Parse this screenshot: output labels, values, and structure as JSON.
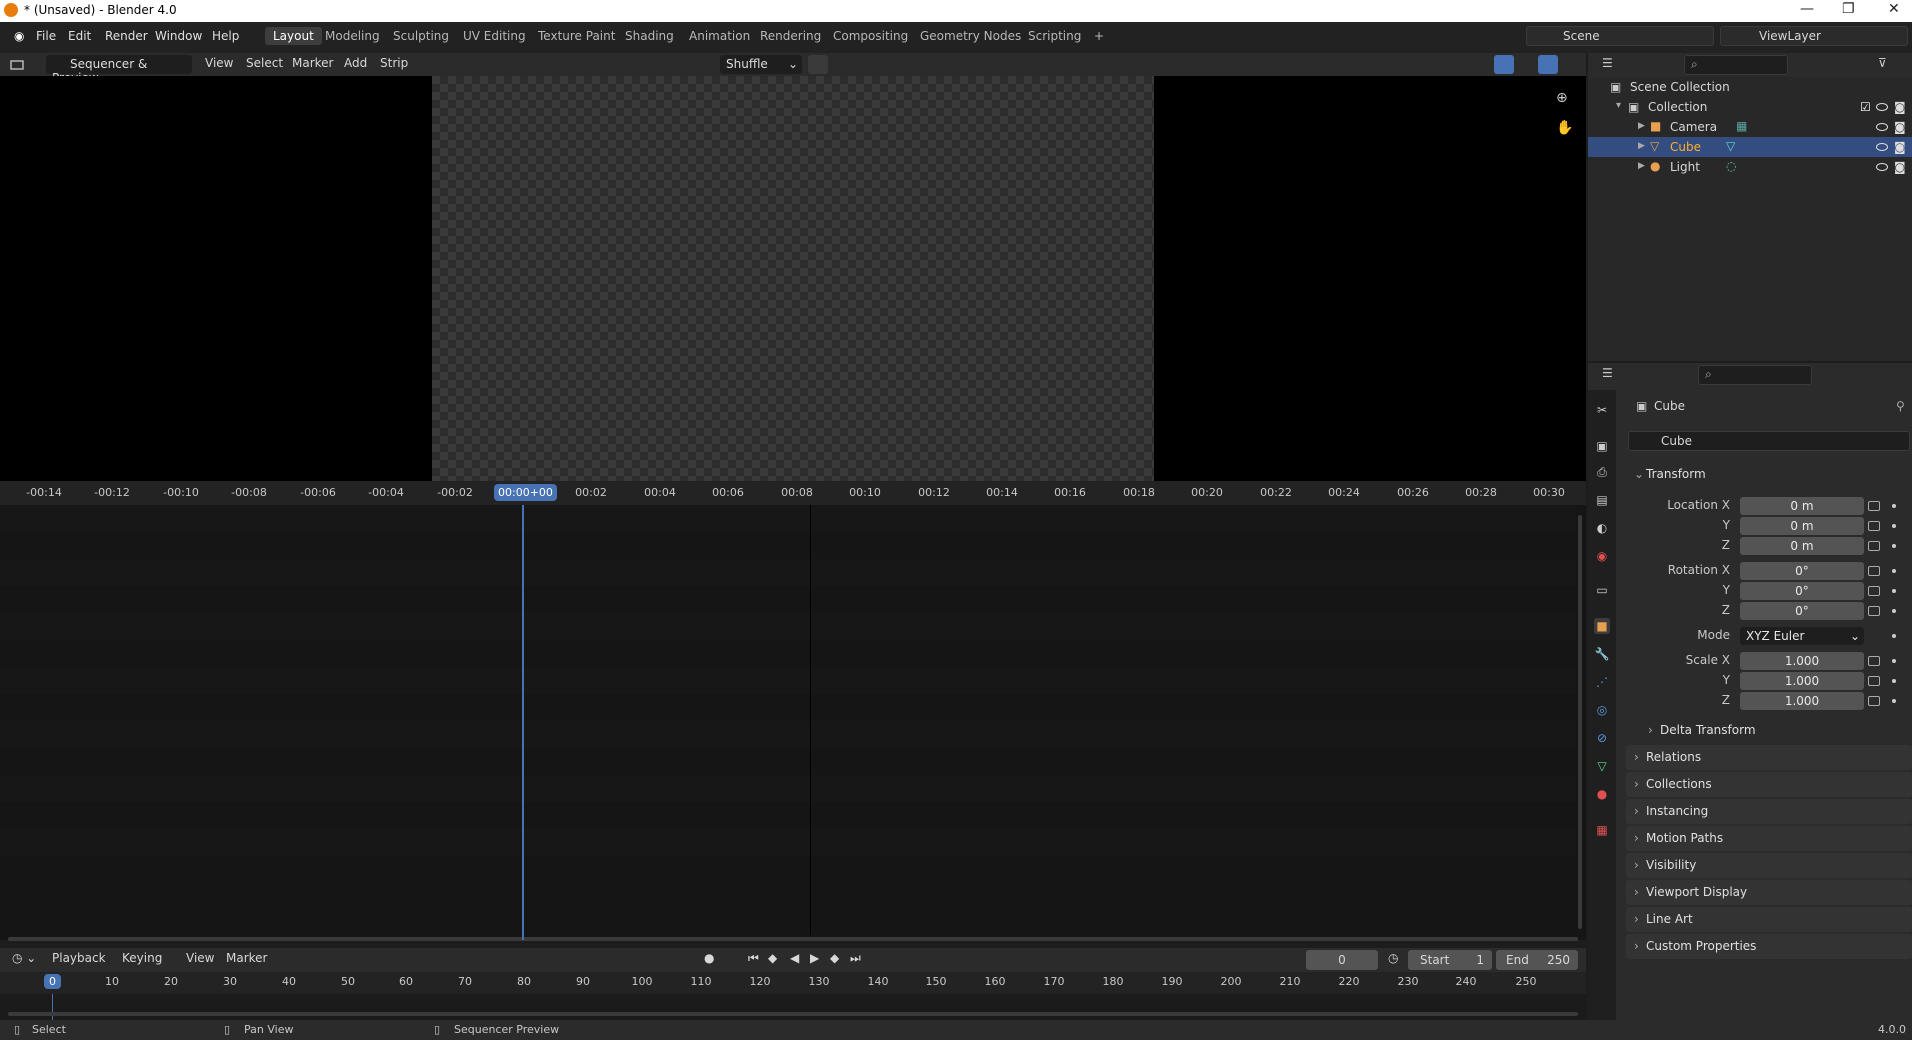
{
  "window": {
    "title": "* (Unsaved) - Blender 4.0",
    "controls": [
      "—",
      "❐",
      "✕"
    ]
  },
  "menu": [
    "File",
    "Edit",
    "Render",
    "Window",
    "Help"
  ],
  "workspaces": [
    "Layout",
    "Modeling",
    "Sculpting",
    "UV Editing",
    "Texture Paint",
    "Shading",
    "Animation",
    "Rendering",
    "Compositing",
    "Geometry Nodes",
    "Scripting",
    "+"
  ],
  "scene": {
    "name": "Scene",
    "view_layer": "ViewLayer"
  },
  "sequencer": {
    "mode": "Sequencer & Preview",
    "menus": [
      "View",
      "Select",
      "Marker",
      "Add",
      "Strip"
    ],
    "overlap_mode": "Shuffle"
  },
  "ruler": {
    "ticks": [
      "-00:14",
      "-00:12",
      "-00:10",
      "-00:08",
      "-00:06",
      "-00:04",
      "-00:02",
      "00:02",
      "00:04",
      "00:06",
      "00:08",
      "00:10",
      "00:12",
      "00:14",
      "00:16",
      "00:18",
      "00:20",
      "00:22",
      "00:24",
      "00:26",
      "00:28",
      "00:30"
    ],
    "current": "00:00+00"
  },
  "timeline": {
    "menus": [
      "Playback",
      "Keying",
      "View",
      "Marker"
    ],
    "current_frame": "0",
    "start_label": "Start",
    "start_value": "1",
    "end_label": "End",
    "end_value": "250",
    "ticks": [
      "10",
      "20",
      "30",
      "40",
      "50",
      "60",
      "70",
      "80",
      "90",
      "100",
      "110",
      "120",
      "130",
      "140",
      "150",
      "160",
      "170",
      "180",
      "190",
      "200",
      "210",
      "220",
      "230",
      "240",
      "250"
    ],
    "playhead": "0"
  },
  "status": {
    "select": "Select",
    "pan": "Pan View",
    "context": "Sequencer Preview",
    "version": "4.0.0"
  },
  "outliner": {
    "root": "Scene Collection",
    "collection": "Collection",
    "items": [
      "Camera",
      "Cube",
      "Light"
    ]
  },
  "properties": {
    "object_name": "Cube",
    "datablock": "Cube",
    "transform_label": "Transform",
    "location_label": "Location X",
    "rotation_label": "Rotation X",
    "scale_label": "Scale X",
    "axis_y": "Y",
    "axis_z": "Z",
    "mode_label": "Mode",
    "location": [
      "0 m",
      "0 m",
      "0 m"
    ],
    "rotation": [
      "0°",
      "0°",
      "0°"
    ],
    "rotation_mode": "XYZ Euler",
    "scale": [
      "1.000",
      "1.000",
      "1.000"
    ],
    "delta": "Delta Transform",
    "panels": [
      "Relations",
      "Collections",
      "Instancing",
      "Motion Paths",
      "Visibility",
      "Viewport Display",
      "Line Art",
      "Custom Properties"
    ]
  },
  "colors": {
    "accent": "#4772b3",
    "selection": "#334d80",
    "orange": "#e87d0d"
  }
}
